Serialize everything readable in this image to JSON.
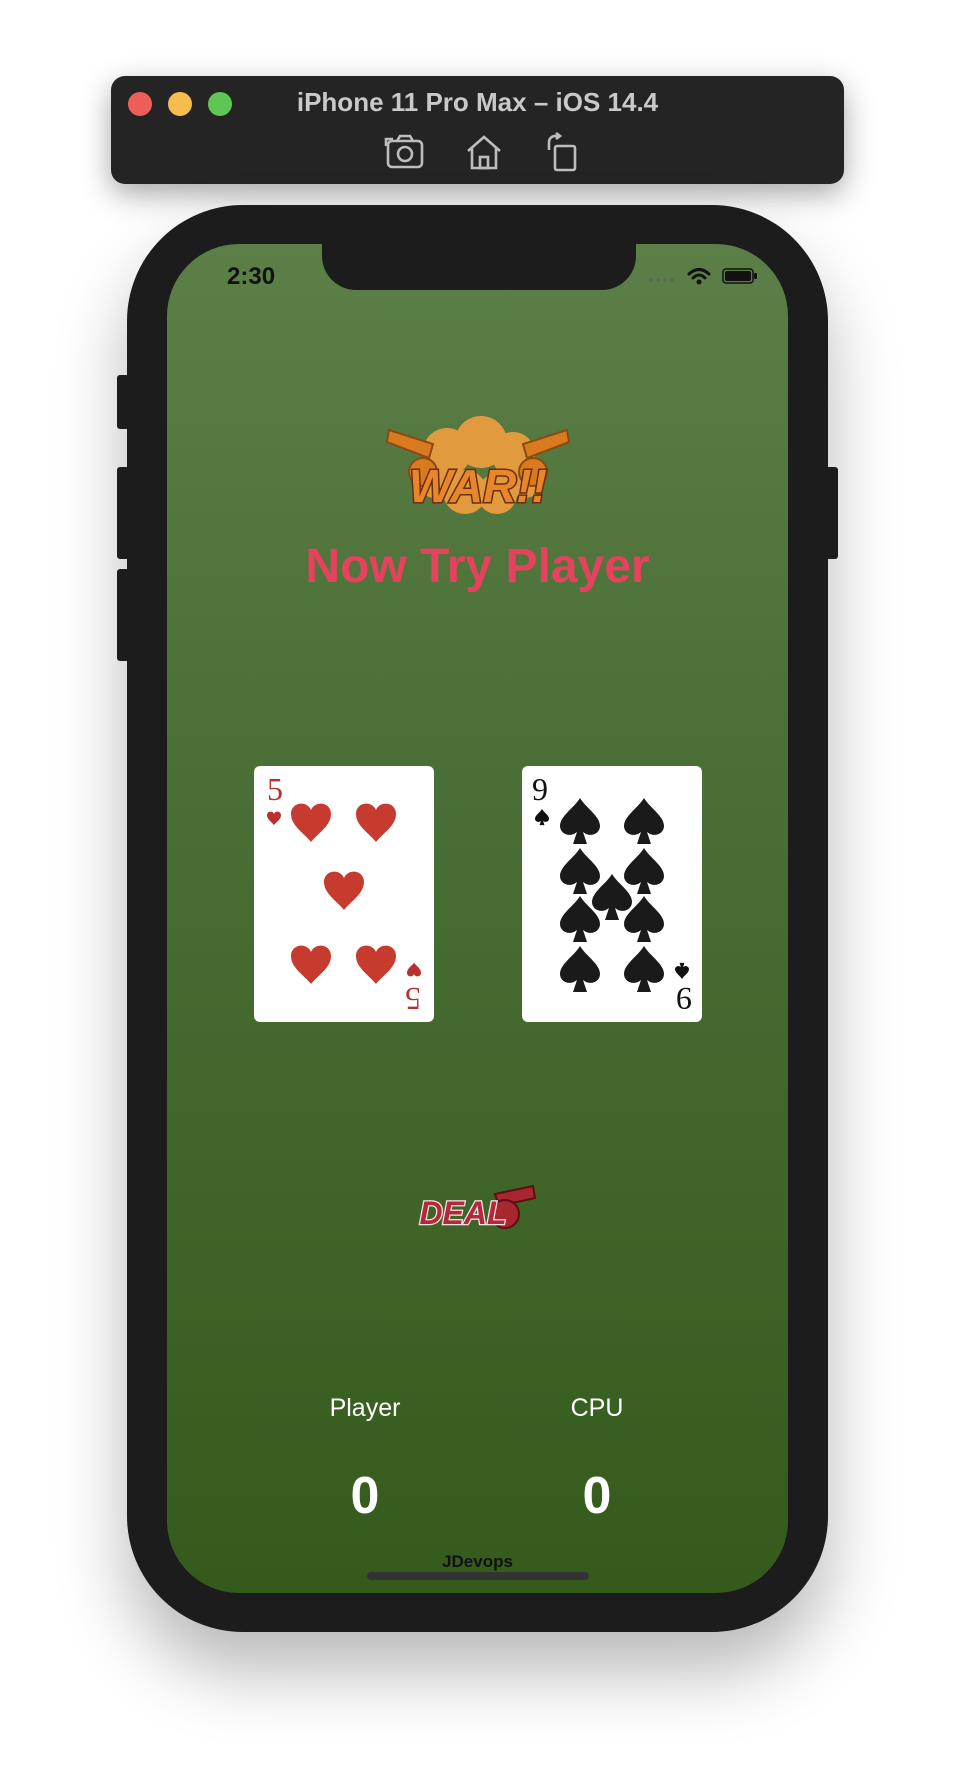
{
  "simulator": {
    "title": "iPhone 11 Pro Max – iOS 14.4",
    "tools": [
      "screenshot-icon",
      "home-icon",
      "rotate-icon"
    ]
  },
  "status_bar": {
    "time": "2:30",
    "icons": [
      "signal-icon",
      "wifi-icon",
      "battery-icon"
    ]
  },
  "app": {
    "logo_text": "WAR!!",
    "heading": "Now Try Player",
    "player_card": {
      "rank": "5",
      "suit": "hearts",
      "color": "#c0392b"
    },
    "cpu_card": {
      "rank": "9",
      "suit": "spades",
      "color": "#111111"
    },
    "deal_label": "DEAL",
    "player_label": "Player",
    "cpu_label": "CPU",
    "player_score": "0",
    "cpu_score": "0",
    "footer": "JDevops"
  },
  "colors": {
    "heading": "#e4425d",
    "background_top": "#5b7f47",
    "background_bottom": "#345a1c"
  }
}
